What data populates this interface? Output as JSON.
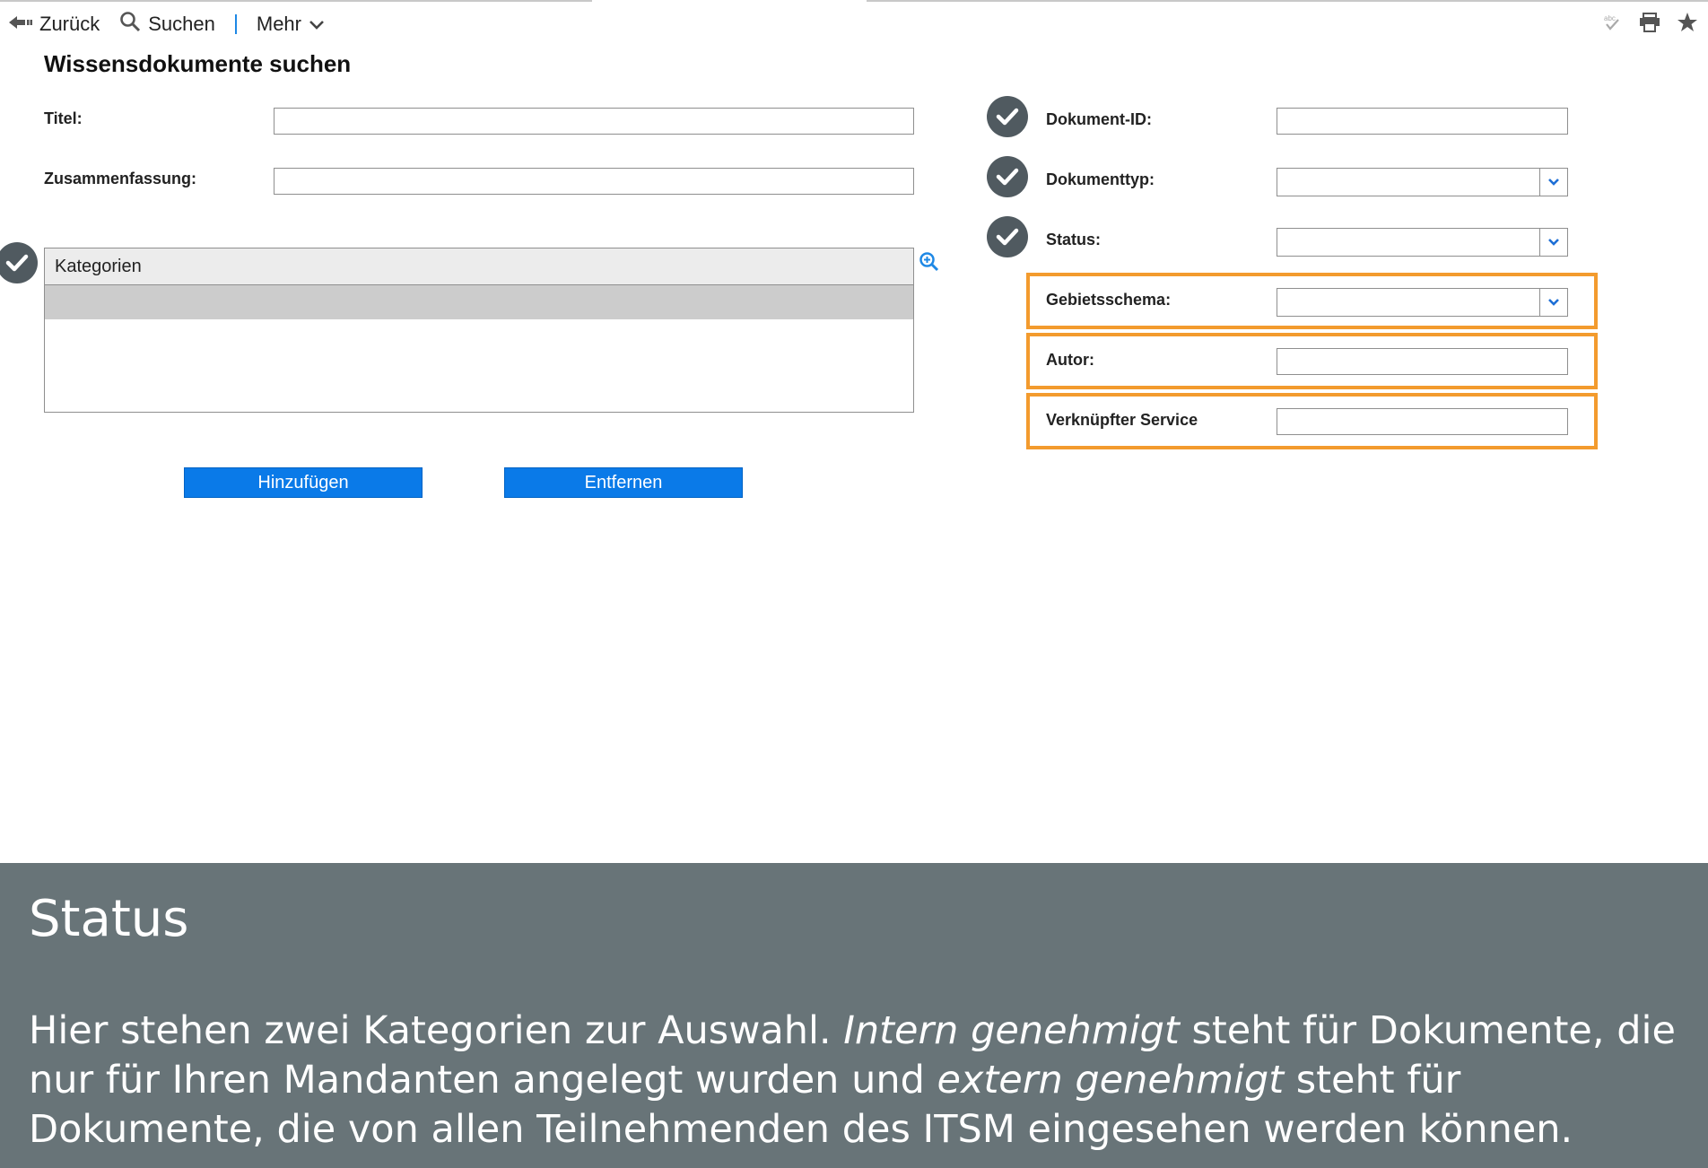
{
  "toolbar": {
    "back_label": "Zurück",
    "search_label": "Suchen",
    "more_label": "Mehr",
    "right_icons": [
      "spellcheck-icon",
      "print-icon",
      "star-icon"
    ]
  },
  "page": {
    "title": "Wissensdokumente suchen"
  },
  "left_form": {
    "title_label": "Titel:",
    "title_value": "",
    "summary_label": "Zusammenfassung:",
    "summary_value": "",
    "categories_header": "Kategorien",
    "add_button": "Hinzufügen",
    "remove_button": "Entfernen"
  },
  "right_form": {
    "doc_id_label": "Dokument-ID:",
    "doc_id_value": "",
    "doc_type_label": "Dokumenttyp:",
    "doc_type_value": "",
    "status_label": "Status:",
    "status_value": "",
    "locale_label": "Gebietsschema:",
    "locale_value": "",
    "author_label": "Autor:",
    "author_value": "",
    "linked_service_label": "Verknüpfter Service",
    "linked_service_value": ""
  },
  "colors": {
    "accent_blue": "#0a7ae8",
    "highlight_orange": "#f39b2e",
    "check_badge": "#505a60",
    "caption_bg": "#687478"
  },
  "caption": {
    "title": "Status",
    "text_1": "Hier stehen zwei Kategorien zur Auswahl. ",
    "em_1": "Intern genehmigt",
    "text_2": " steht für Dokumente, die nur für Ihren Mandanten angelegt wurden und ",
    "em_2": "extern genehmigt",
    "text_3": " steht für Dokumente, die von allen Teilnehmenden des ITSM eingesehen werden können."
  }
}
